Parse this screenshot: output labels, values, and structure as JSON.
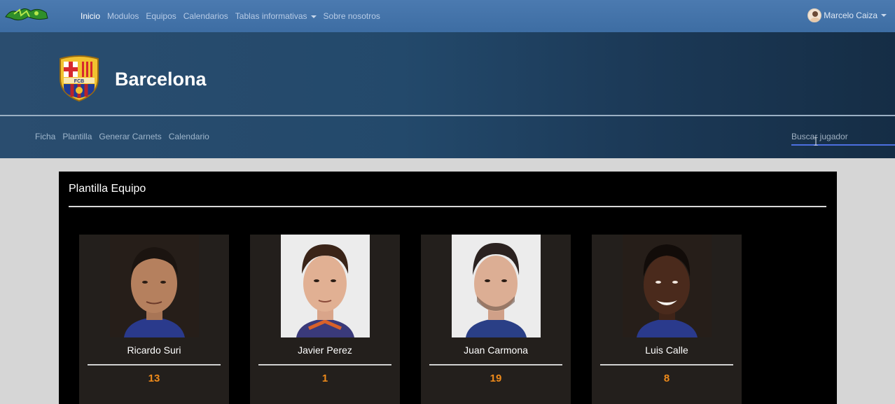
{
  "nav": {
    "links": [
      "Inicio",
      "Modulos",
      "Equipos",
      "Calendarios",
      "Tablas informativas",
      "Sobre nosotros"
    ],
    "user_name": "Marcelo Caiza"
  },
  "team": {
    "name": "Barcelona",
    "crest_text": "FCB"
  },
  "subnav": {
    "links": [
      "Ficha",
      "Plantilla",
      "Generar Carnets",
      "Calendario"
    ],
    "search_placeholder": "Buscar jugador"
  },
  "panel": {
    "title": "Plantilla Equipo",
    "players": [
      {
        "name": "Ricardo Suri",
        "number": "13"
      },
      {
        "name": "Javier Perez",
        "number": "1"
      },
      {
        "name": "Juan Carmona",
        "number": "19"
      },
      {
        "name": "Luis Calle",
        "number": "8"
      }
    ]
  },
  "colors": {
    "navbar": "#3f6fa6",
    "accent_number": "#ee8a1a",
    "search_underline": "#4c6fe0"
  }
}
